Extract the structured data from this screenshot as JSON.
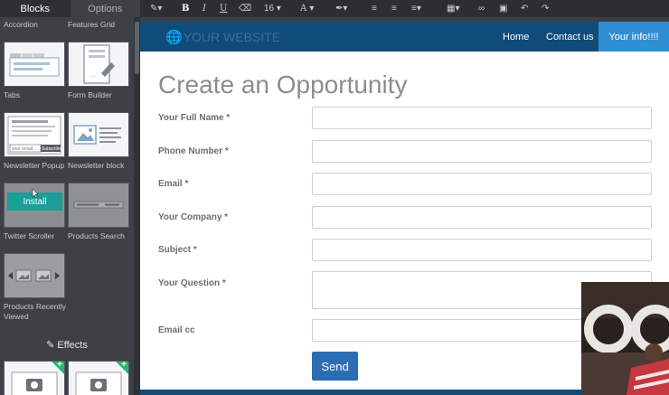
{
  "sidebar": {
    "tabs": [
      "Blocks",
      "Options"
    ],
    "top_labels": [
      "Accordion",
      "Features Grid"
    ],
    "blocks": [
      {
        "label": "Tabs"
      },
      {
        "label": "Form Builder"
      },
      {
        "label": "Newsletter Popup"
      },
      {
        "label": "Newsletter block"
      },
      {
        "label": "Twitter Scroller"
      },
      {
        "label": "Products Search"
      },
      {
        "label": "Products Recently Viewed"
      }
    ],
    "newsletter_thumb": {
      "placeholder": "your email...",
      "button": "Subscribe"
    },
    "install_label": "Install",
    "section_effects": "Effects"
  },
  "toolbar": {
    "font_size": "16"
  },
  "site": {
    "logo_text": "YOUR WEBSITE",
    "nav": [
      "Home",
      "Contact us",
      "Your info!!!!"
    ],
    "page_title": "Create an Opportunity",
    "fields": [
      "Your Full Name *",
      "Phone Number *",
      "Email *",
      "Your Company *",
      "Subject *",
      "Your Question *",
      "Email cc"
    ],
    "send_label": "Send"
  },
  "colors": {
    "nav_bar": "#0f4c7a",
    "nav_active": "#2f8fd3",
    "install": "#1a9e96",
    "send": "#2a6db2",
    "new_badge": "#2bb673"
  }
}
